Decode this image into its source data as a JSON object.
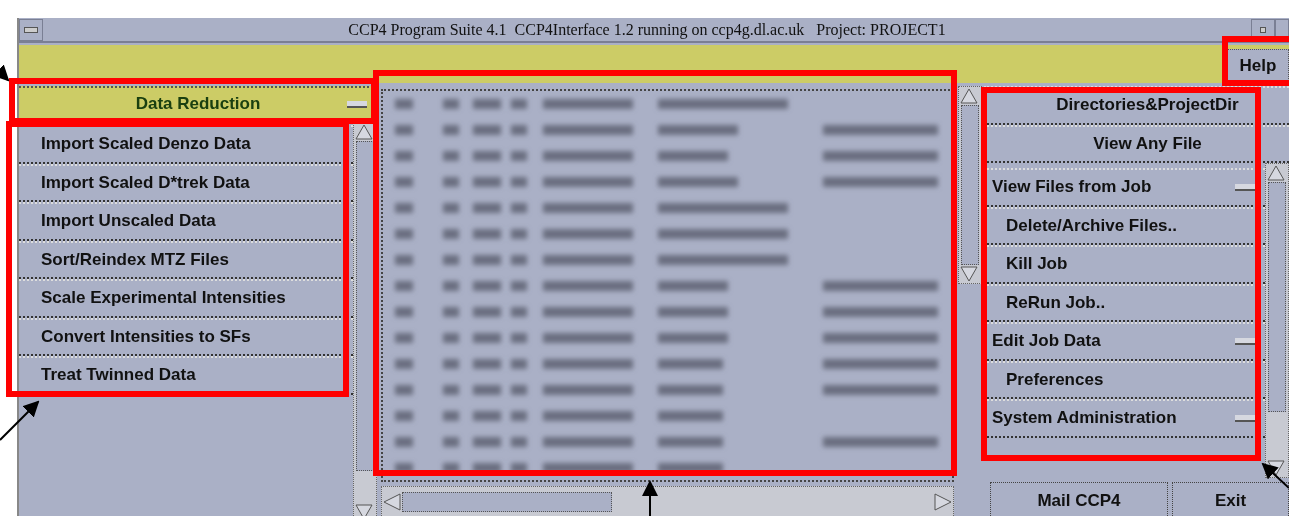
{
  "window": {
    "title": "CCP4 Program Suite 4.1  CCP4Interface 1.2 running on ccp4g.dl.ac.uk   Project: PROJECT1"
  },
  "toolbar": {
    "help_button": "Help"
  },
  "module_menu": {
    "label": "Data Reduction",
    "has_submenu": true,
    "items": [
      {
        "label": "Import Scaled Denzo Data"
      },
      {
        "label": "Import Scaled D*trek Data"
      },
      {
        "label": "Import Unscaled Data"
      },
      {
        "label": "Sort/Reindex MTZ Files"
      },
      {
        "label": "Scale Experimental Intensities"
      },
      {
        "label": "Convert Intensities to SFs"
      },
      {
        "label": "Treat Twinned Data"
      }
    ]
  },
  "side_menu": {
    "items": [
      {
        "label": "Directories&ProjectDir",
        "kind": "wide",
        "has_submenu": false
      },
      {
        "label": "View Any File",
        "kind": "wide",
        "has_submenu": false
      },
      {
        "label": "View Files from Job",
        "kind": "list",
        "has_submenu": true
      },
      {
        "label": "Delete/Archive Files..",
        "kind": "list",
        "has_submenu": false
      },
      {
        "label": "Kill Job",
        "kind": "list",
        "has_submenu": false
      },
      {
        "label": "ReRun Job..",
        "kind": "list",
        "has_submenu": false
      },
      {
        "label": "Edit Job Data",
        "kind": "list",
        "has_submenu": true
      },
      {
        "label": "Preferences",
        "kind": "list",
        "has_submenu": false
      },
      {
        "label": "System Administration",
        "kind": "list",
        "has_submenu": true
      }
    ]
  },
  "footer_buttons": [
    "Mail CCP4",
    "Exit"
  ]
}
